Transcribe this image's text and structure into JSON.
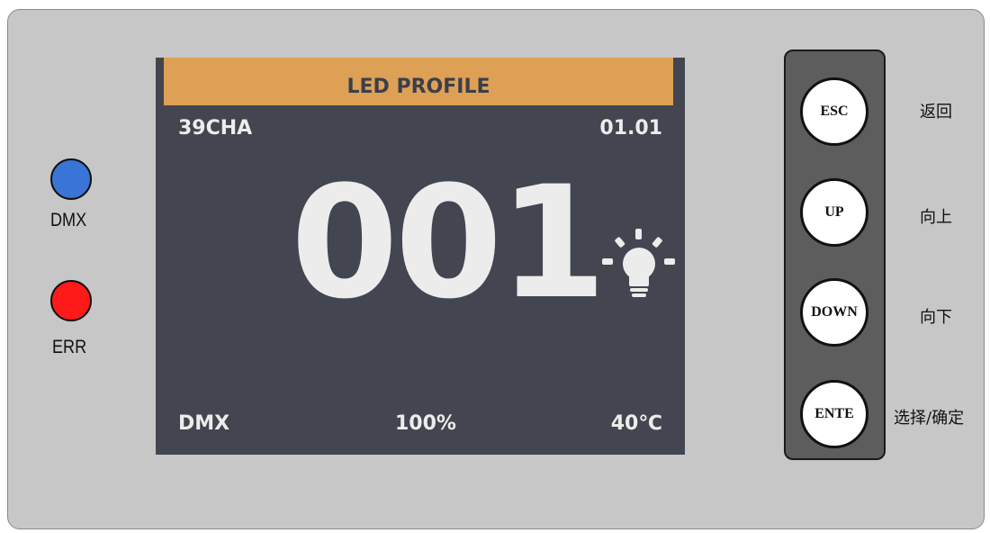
{
  "indicators": {
    "dmx": {
      "label": "DMX",
      "color": "#3a74d6"
    },
    "err": {
      "label": "ERR",
      "color": "#ff1a1a"
    }
  },
  "screen": {
    "title": "LED PROFILE",
    "title_bar_color": "#dea055",
    "background_color": "#434650",
    "channel_mode": "39CHA",
    "version": "01.01",
    "address": "001",
    "status_icon": "light-bulb-icon",
    "signal_source": "DMX",
    "dimmer": "100%",
    "temperature": "40℃"
  },
  "buttons": [
    {
      "key": "ESC",
      "description": "返回"
    },
    {
      "key": "UP",
      "description": "向上"
    },
    {
      "key": "DOWN",
      "description": "向下"
    },
    {
      "key": "ENTE",
      "description": "选择/确定"
    }
  ]
}
